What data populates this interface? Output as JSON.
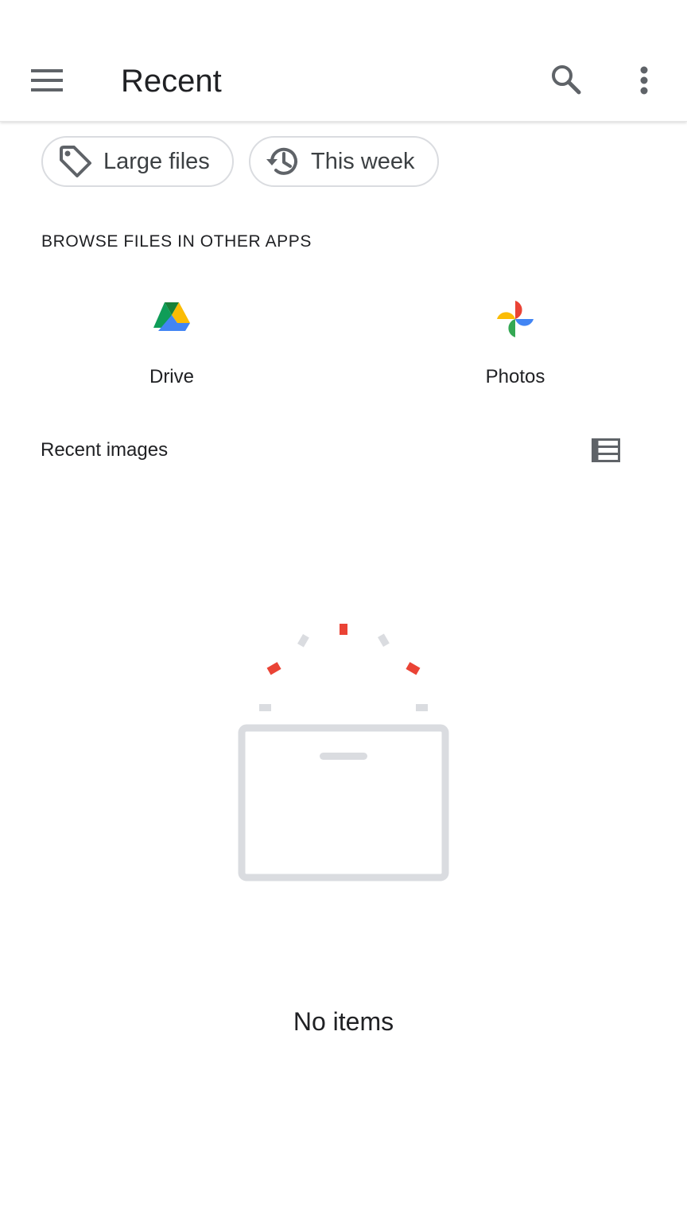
{
  "appbar": {
    "title": "Recent",
    "menu_icon": "hamburger-menu-icon",
    "search_icon": "search-icon",
    "more_icon": "more-vert-icon"
  },
  "chips": [
    {
      "label": "Large files",
      "icon": "label-tag-icon"
    },
    {
      "label": "This week",
      "icon": "history-icon"
    }
  ],
  "browse_section": {
    "heading": "BROWSE FILES IN OTHER APPS",
    "apps": [
      {
        "label": "Drive",
        "icon": "google-drive-icon"
      },
      {
        "label": "Photos",
        "icon": "google-photos-icon"
      }
    ]
  },
  "recent_images": {
    "heading": "Recent images",
    "view_toggle_icon": "list-view-icon"
  },
  "empty_state": {
    "text": "No items",
    "illustration": "empty-box-illustration",
    "colors": {
      "accent": "#ea4335",
      "muted": "#dadce0"
    }
  }
}
